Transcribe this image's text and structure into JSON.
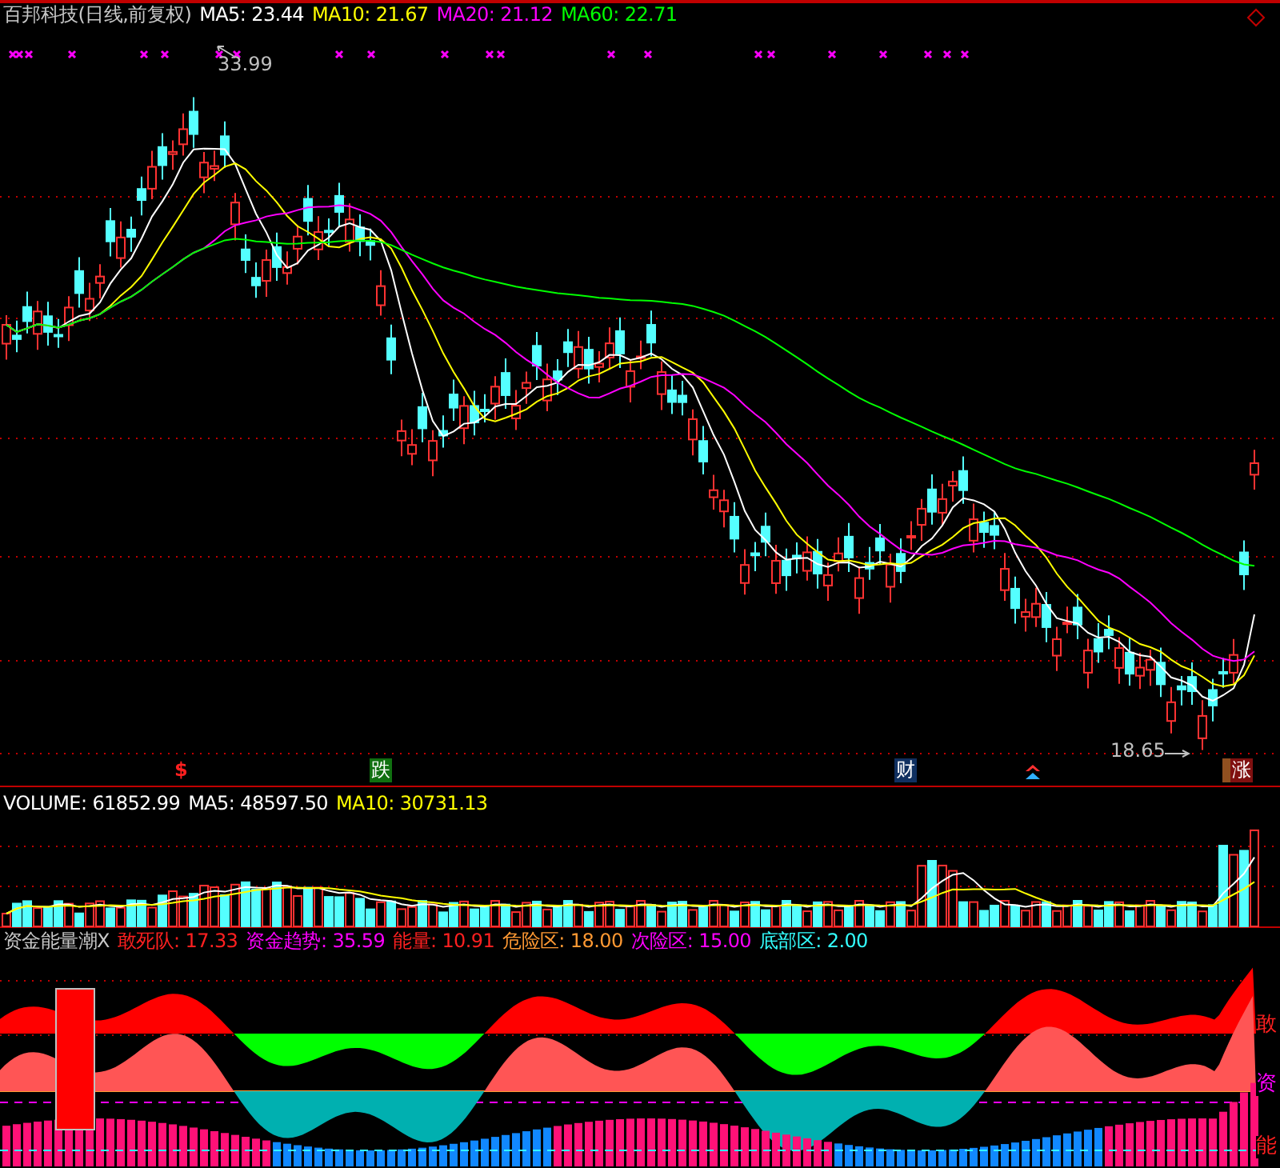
{
  "header": {
    "title": "百邦科技(日线,前复权)",
    "items": [
      {
        "label": "MA5: 23.44",
        "color": "#ffffff"
      },
      {
        "label": "MA10: 21.67",
        "color": "#ffff00"
      },
      {
        "label": "MA20: 21.12",
        "color": "#ff00ff"
      },
      {
        "label": "MA60: 22.71",
        "color": "#00ff00"
      }
    ]
  },
  "price_labels": [
    {
      "kind": "high",
      "text": "33.99"
    },
    {
      "kind": "low",
      "text": "18.65"
    }
  ],
  "signals": [
    {
      "kind": "plain",
      "text": "$"
    },
    {
      "kind": "fall",
      "text": "跌"
    },
    {
      "kind": "finance",
      "text": "财"
    },
    {
      "kind": "rise",
      "text": "涨"
    }
  ],
  "volume": {
    "items": [
      {
        "label": "VOLUME: 61852.99",
        "color": "#ffffff"
      },
      {
        "label": "MA5: 48597.50",
        "color": "#ffffff"
      },
      {
        "label": "MA10: 30731.13",
        "color": "#ffff00"
      }
    ]
  },
  "indicator": {
    "title": "资金能量潮X",
    "items": [
      {
        "label": "敢死队: 17.33",
        "color": "#ff2020"
      },
      {
        "label": "资金趋势: 35.59",
        "color": "#ff00ff"
      },
      {
        "label": "能量: 10.91",
        "color": "#ff2020"
      },
      {
        "label": "危险区: 18.00",
        "color": "#ff9933"
      },
      {
        "label": "次险区: 15.00",
        "color": "#ff00ff"
      },
      {
        "label": "底部区: 2.00",
        "color": "#33ffff"
      }
    ],
    "edge_labels": [
      {
        "text": "敢",
        "color": "#ff2020"
      },
      {
        "text": "资",
        "color": "#ff00ff"
      },
      {
        "text": "能",
        "color": "#ff2020"
      }
    ]
  }
}
